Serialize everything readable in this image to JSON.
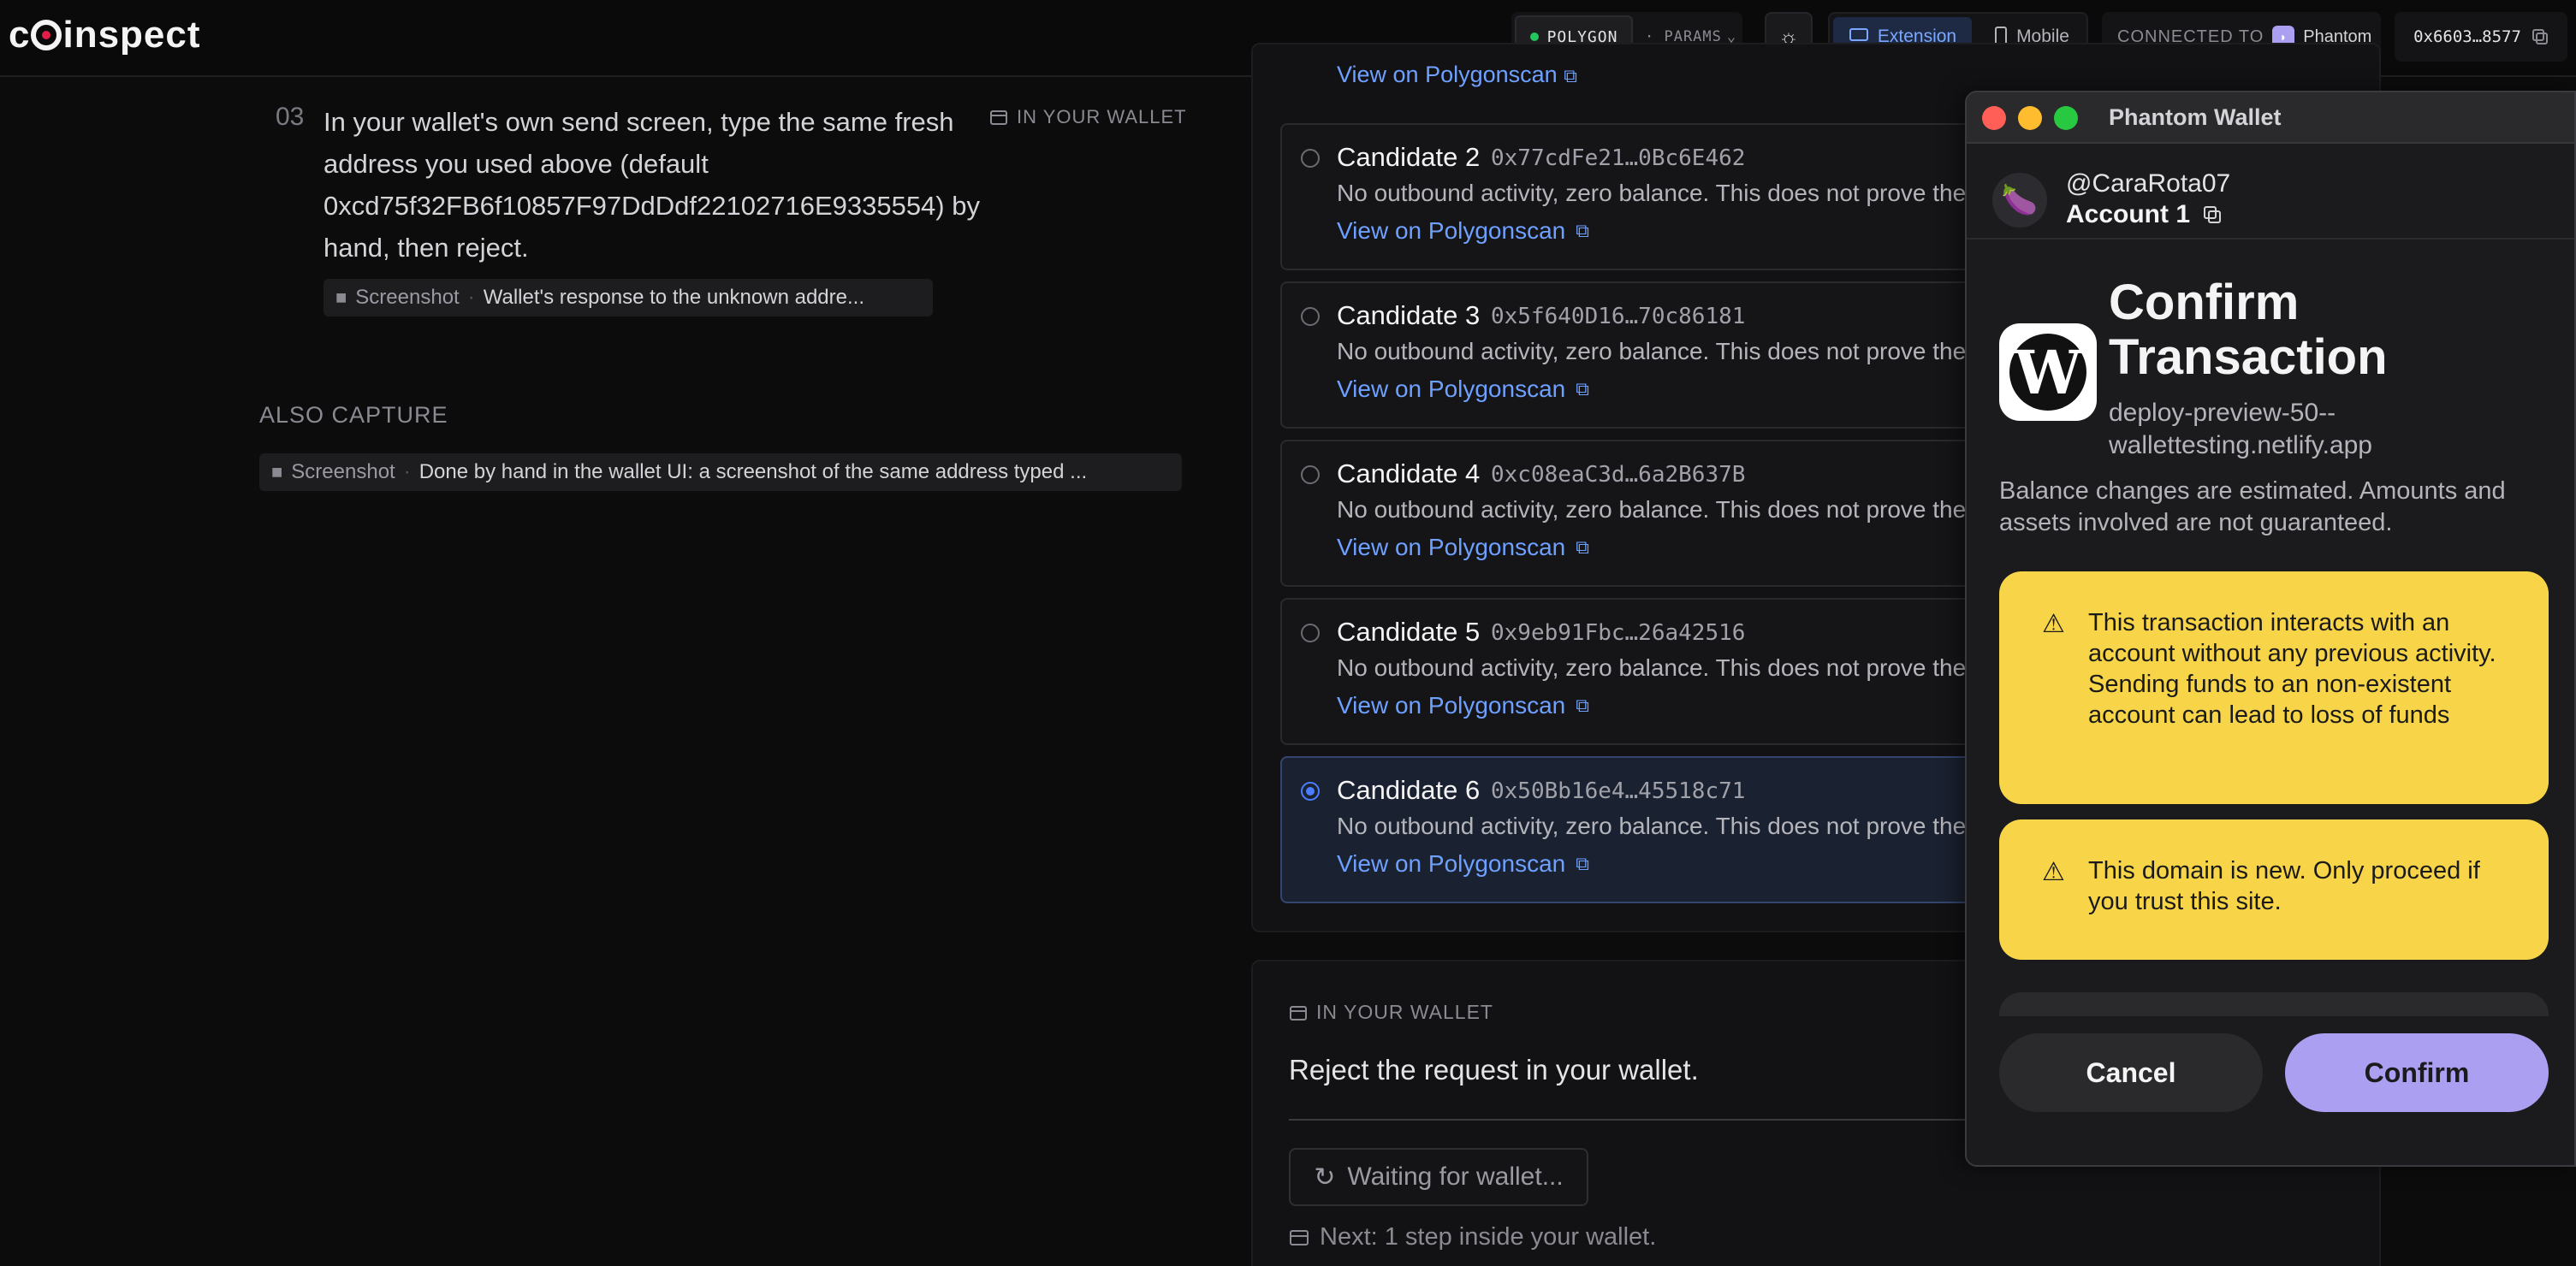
{
  "header": {
    "logo_text": "c   inspect",
    "network": "POLYGON",
    "params": "· PARAMS",
    "mode_extension": "Extension",
    "mode_mobile": "Mobile",
    "connected_label": "CONNECTED TO",
    "connected_wallet": "Phantom",
    "account_short": "0x6603…8577",
    "accent_color": "#4a7dff"
  },
  "step": {
    "number": "03",
    "text": "In your wallet's own send screen, type the same fresh address you used above (default 0xcd75f32FB6f10857F97DdDdf22102716E9335554) by hand, then reject.",
    "tag": "IN YOUR WALLET",
    "screenshot_label": "Screenshot",
    "screenshot_desc": "Wallet's response to the unknown addre..."
  },
  "also_capture": {
    "heading": "ALSO CAPTURE",
    "screenshot_label": "Screenshot",
    "screenshot_desc": "Done by hand in the wallet UI: a screenshot of the same address typed ..."
  },
  "candidates": {
    "top_link": "View on Polygonscan",
    "items": [
      {
        "title": "Candidate 2",
        "address": "0x77cdFe21…0Bc6E462",
        "desc": "No outbound activity, zero balance. This does not prove the",
        "link": "View on Polygonscan",
        "selected": false
      },
      {
        "title": "Candidate 3",
        "address": "0x5f640D16…70c86181",
        "desc": "No outbound activity, zero balance. This does not prove the",
        "link": "View on Polygonscan",
        "selected": false
      },
      {
        "title": "Candidate 4",
        "address": "0xc08eaC3d…6a2B637B",
        "desc": "No outbound activity, zero balance. This does not prove the",
        "link": "View on Polygonscan",
        "selected": false
      },
      {
        "title": "Candidate 5",
        "address": "0x9eb91Fbc…26a42516",
        "desc": "No outbound activity, zero balance. This does not prove the",
        "link": "View on Polygonscan",
        "selected": false
      },
      {
        "title": "Candidate 6",
        "address": "0x50Bb16e4…45518c71",
        "desc": "No outbound activity, zero balance. This does not prove the",
        "link": "View on Polygonscan",
        "selected": true
      }
    ]
  },
  "reject": {
    "tag": "IN YOUR WALLET",
    "text": "Reject the request in your wallet.",
    "waiting": "Waiting for wallet...",
    "next": "Next: 1 step inside your wallet."
  },
  "wallet": {
    "window_title": "Phantom Wallet",
    "handle": "@CaraRota07",
    "account": "Account 1",
    "site_logo_letter": "W",
    "confirm_title": "Confirm Transaction",
    "domain": "deploy-preview-50--wallettesting.netlify.app",
    "balance_note": "Balance changes are estimated. Amounts and assets involved are not guaranteed.",
    "warnings": [
      "This transaction interacts with an account without any previous activity. Sending funds to an non-existent account can lead to loss of funds",
      "This domain is new. Only proceed if you trust this site."
    ],
    "cancel": "Cancel",
    "confirm": "Confirm",
    "warning_color": "#f8d548",
    "confirm_color": "#ab9ff2"
  }
}
